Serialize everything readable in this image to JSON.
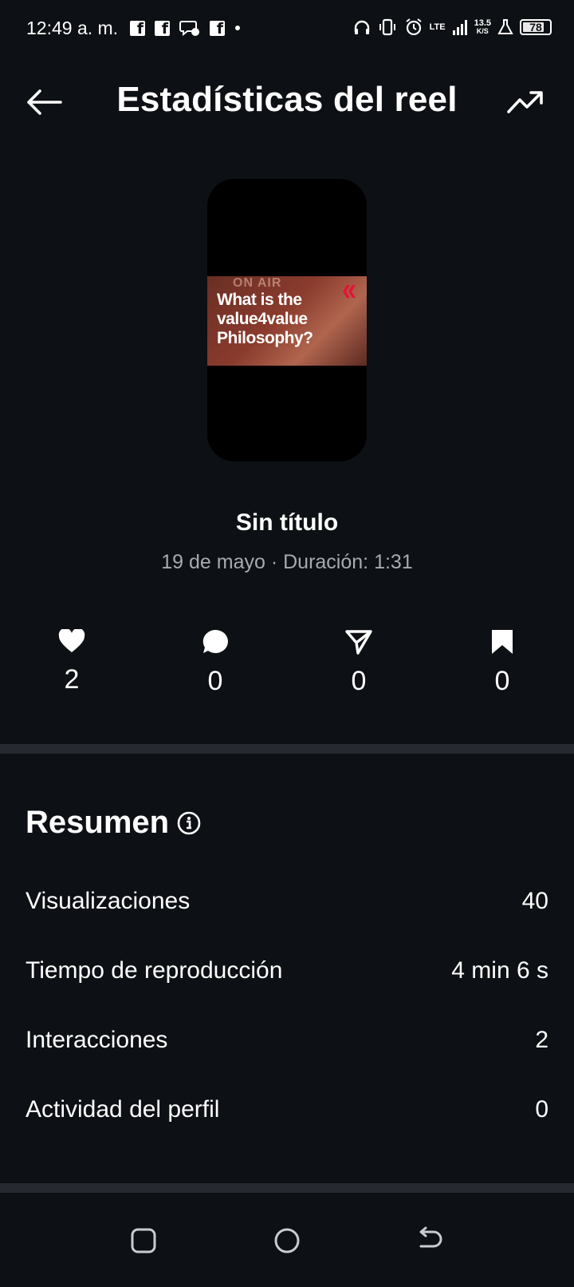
{
  "status_bar": {
    "time": "12:49 a. m.",
    "network": "LTE",
    "speed_value": "13.5",
    "speed_unit": "K/S",
    "battery": "78"
  },
  "header": {
    "title": "Estadísticas del reel"
  },
  "reel": {
    "thumbnail_text": "What is the value4value Philosophy?",
    "thumbnail_overlay": "ON AIR",
    "title": "Sin título",
    "meta": "19 de mayo · Duración: 1:31"
  },
  "counters": [
    {
      "icon": "heart-icon",
      "value": "2"
    },
    {
      "icon": "comment-icon",
      "value": "0"
    },
    {
      "icon": "share-icon",
      "value": "0"
    },
    {
      "icon": "bookmark-icon",
      "value": "0"
    }
  ],
  "summary": {
    "title": "Resumen",
    "rows": [
      {
        "label": "Visualizaciones",
        "value": "40"
      },
      {
        "label": "Tiempo de reproducción",
        "value": "4 min 6 s"
      },
      {
        "label": "Interacciones",
        "value": "2"
      },
      {
        "label": "Actividad del perfil",
        "value": "0"
      }
    ]
  },
  "colors": {
    "background": "#0d1014",
    "divider": "#262a30",
    "secondary_text": "#a6abb2"
  }
}
